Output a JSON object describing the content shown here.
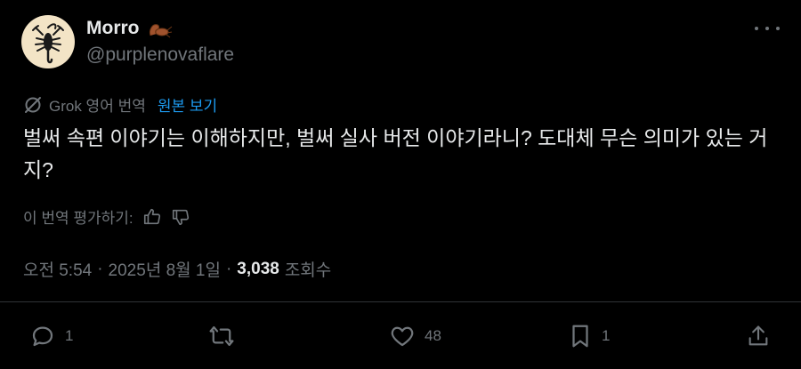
{
  "author": {
    "display_name": "Morro",
    "name_emoji_icon": "scorpion-icon",
    "handle": "@purplenovaflare",
    "avatar_icon": "scorpion-icon"
  },
  "translation": {
    "provider_label": "Grok 영어 번역",
    "show_original_label": "원본 보기"
  },
  "tweet": {
    "text": "벌써 속편 이야기는 이해하지만, 벌써 실사 버전 이야기라니? 도대체 무슨 의미가 있는 거지?"
  },
  "rating": {
    "label": "이 번역 평가하기:"
  },
  "meta": {
    "time": "오전 5:54",
    "separator": "·",
    "date": "2025년 8월 1일",
    "views_count": "3,038",
    "views_label": "조회수"
  },
  "actions": {
    "replies": "1",
    "retweets": "",
    "likes": "48",
    "bookmarks": "1"
  },
  "colors": {
    "background": "#000000",
    "text": "#e7e9ea",
    "muted": "#71767b",
    "link": "#1d9bf0",
    "divider": "#2f3336"
  }
}
